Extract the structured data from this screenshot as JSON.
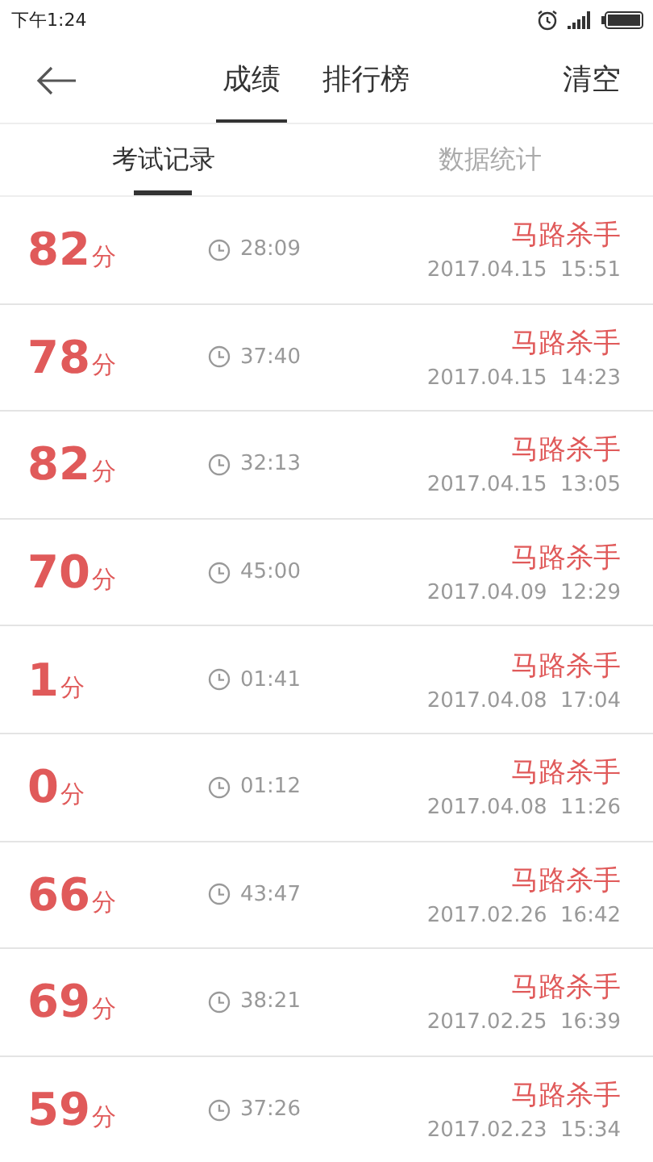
{
  "status_bar": {
    "time": "下午1:24"
  },
  "header": {
    "tabs": [
      {
        "label": "成绩",
        "selected": true
      },
      {
        "label": "排行榜",
        "selected": false
      }
    ],
    "action": "清空"
  },
  "sub_tabs": [
    {
      "label": "考试记录",
      "selected": true
    },
    {
      "label": "数据统计",
      "selected": false
    }
  ],
  "records": [
    {
      "score": "82",
      "unit": "分",
      "duration": "28:09",
      "name": "马路杀手",
      "date": "2017.04.15  15:51"
    },
    {
      "score": "78",
      "unit": "分",
      "duration": "37:40",
      "name": "马路杀手",
      "date": "2017.04.15  14:23"
    },
    {
      "score": "82",
      "unit": "分",
      "duration": "32:13",
      "name": "马路杀手",
      "date": "2017.04.15  13:05"
    },
    {
      "score": "70",
      "unit": "分",
      "duration": "45:00",
      "name": "马路杀手",
      "date": "2017.04.09  12:29"
    },
    {
      "score": "1",
      "unit": "分",
      "duration": "01:41",
      "name": "马路杀手",
      "date": "2017.04.08  17:04"
    },
    {
      "score": "0",
      "unit": "分",
      "duration": "01:12",
      "name": "马路杀手",
      "date": "2017.04.08  11:26"
    },
    {
      "score": "66",
      "unit": "分",
      "duration": "43:47",
      "name": "马路杀手",
      "date": "2017.02.26  16:42"
    },
    {
      "score": "69",
      "unit": "分",
      "duration": "38:21",
      "name": "马路杀手",
      "date": "2017.02.25  16:39"
    },
    {
      "score": "59",
      "unit": "分",
      "duration": "37:26",
      "name": "马路杀手",
      "date": "2017.02.23  15:34"
    }
  ]
}
